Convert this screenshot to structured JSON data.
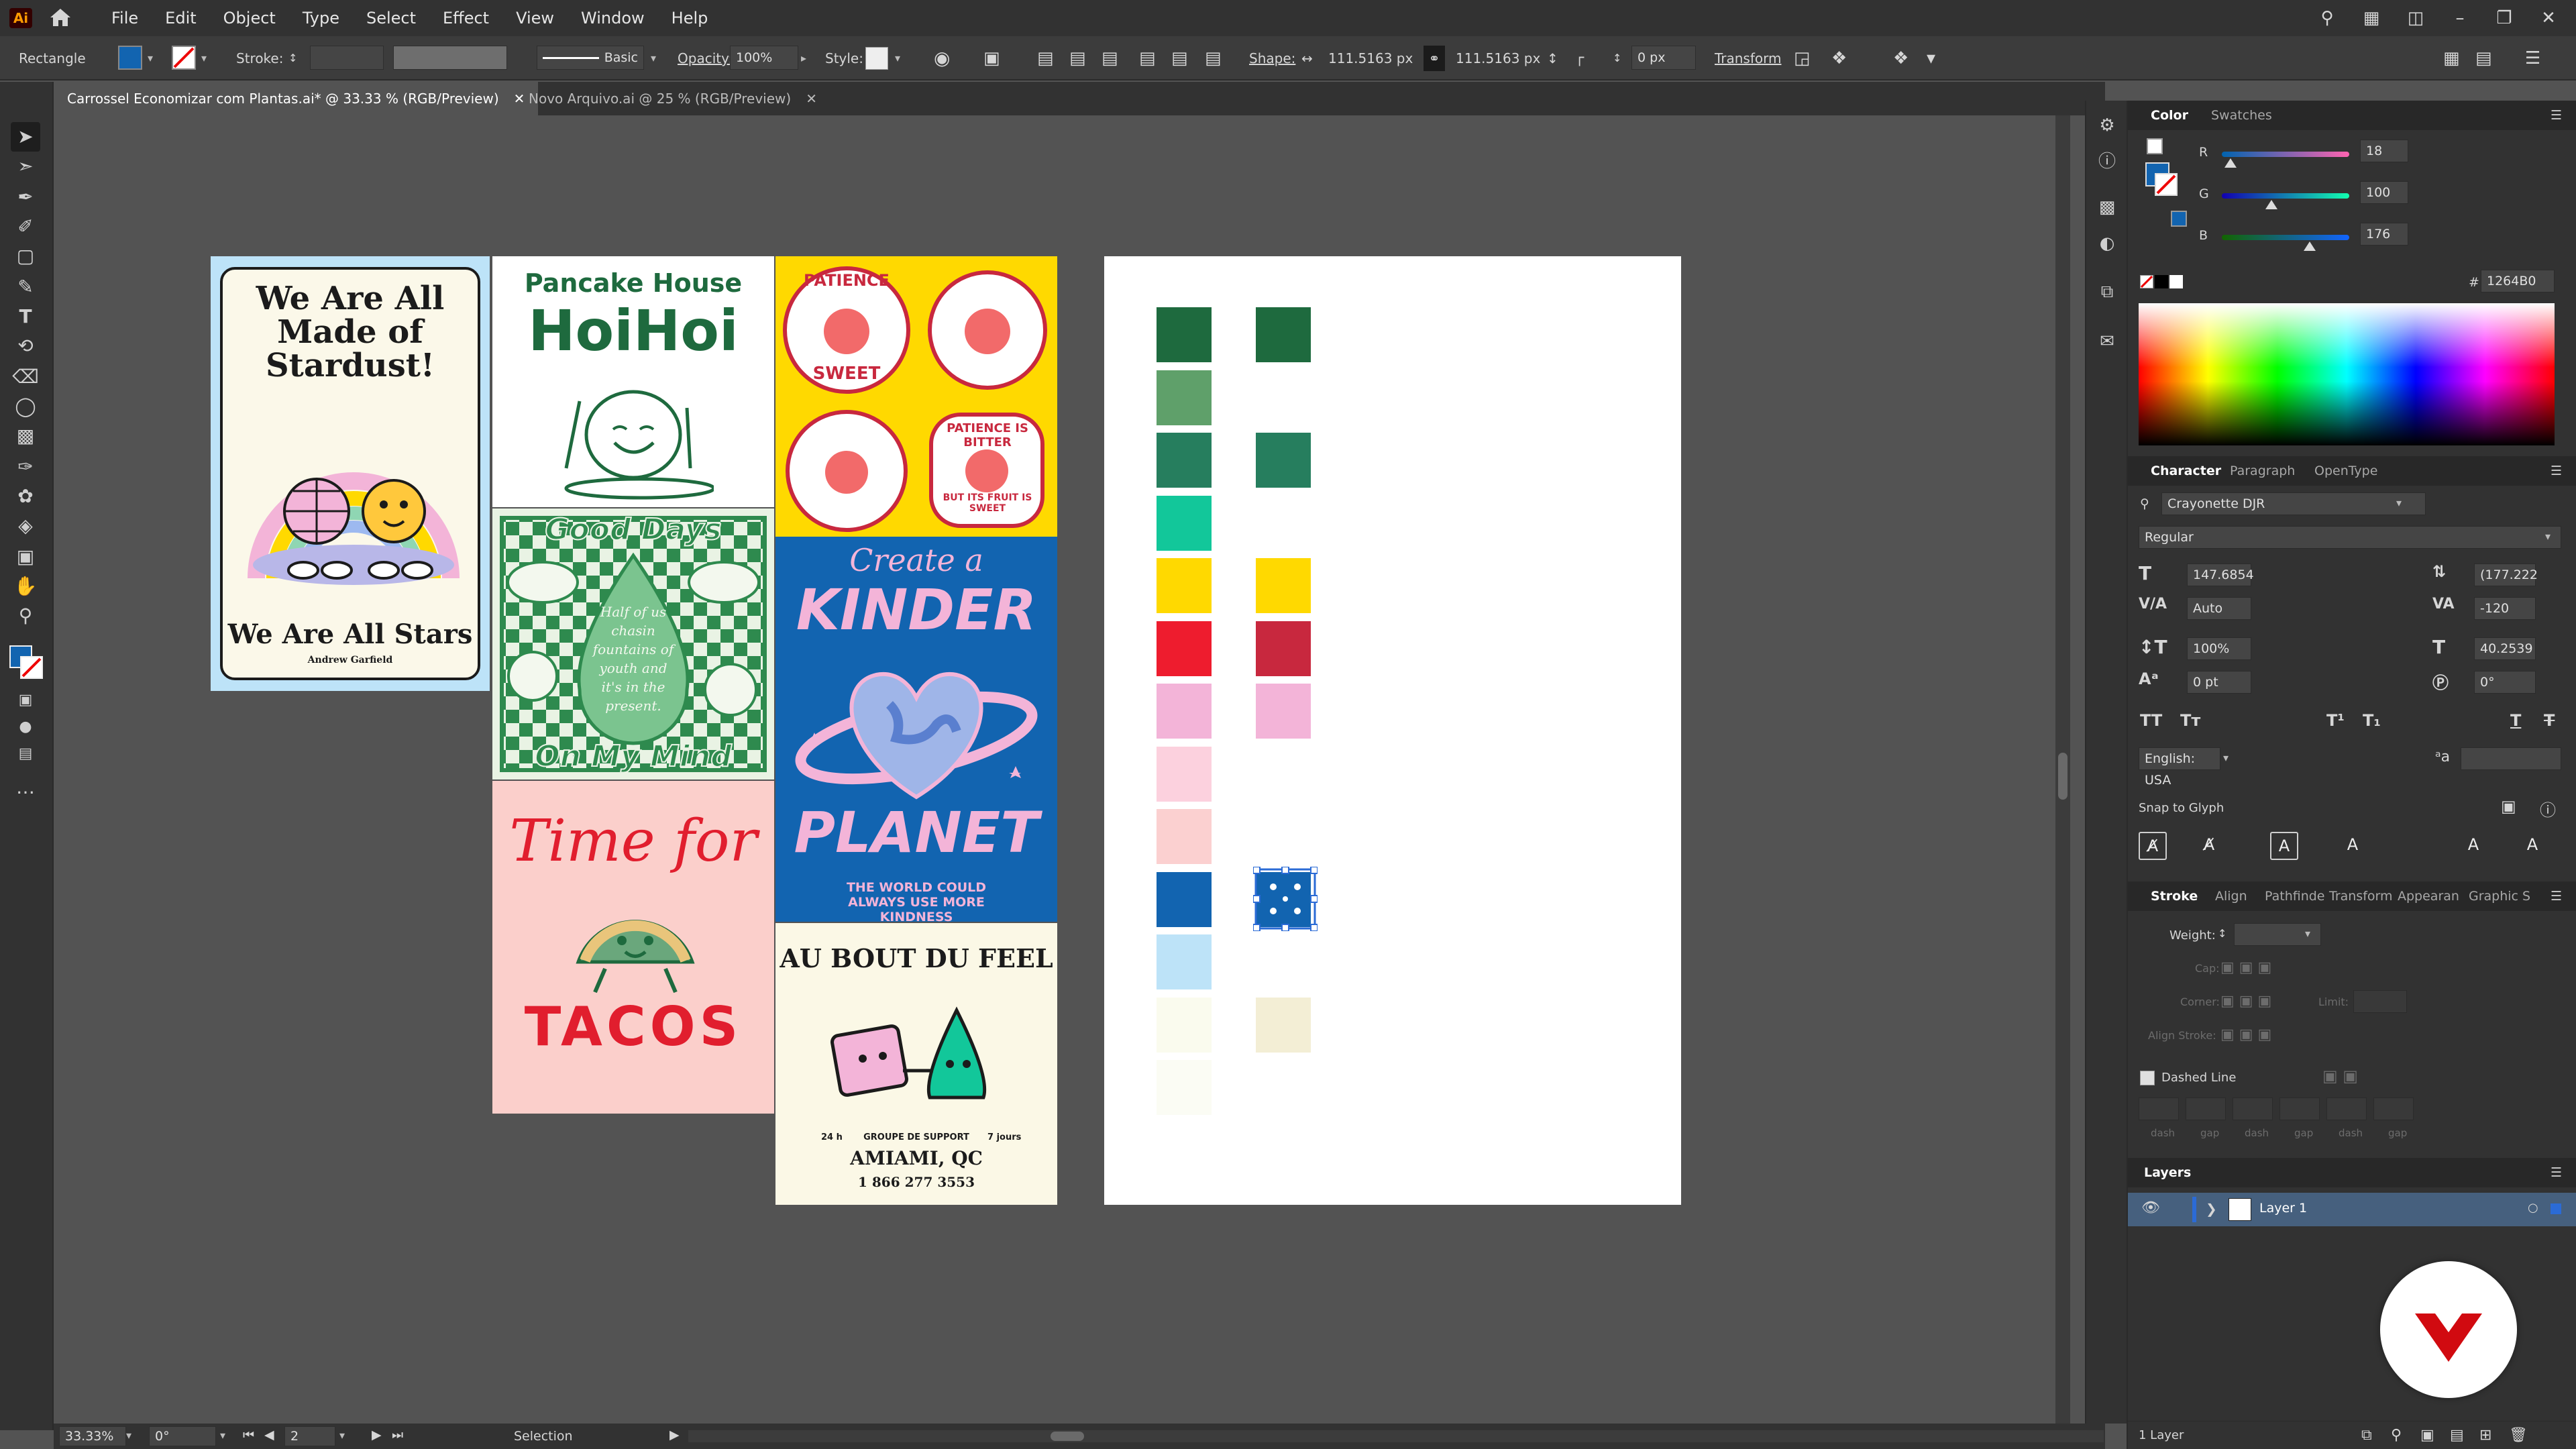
{
  "menubar": {
    "logo": "Ai",
    "menus": [
      "File",
      "Edit",
      "Object",
      "Type",
      "Select",
      "Effect",
      "View",
      "Window",
      "Help"
    ]
  },
  "controlbar": {
    "object_type": "Rectangle",
    "fill_color": "#1264B0",
    "stroke_label": "Stroke:",
    "brush_label": "Basic",
    "opacity_label": "Opacity:",
    "opacity_value": "100%",
    "style_label": "Style:",
    "shape_label": "Shape:",
    "width_value": "111.5163 px",
    "height_value": "111.5163 px",
    "corner_value": "0 px",
    "transform_label": "Transform"
  },
  "tabs": [
    {
      "label": "Carrossel Economizar com Plantas.ai* @ 33.33 % (RGB/Preview)",
      "active": true
    },
    {
      "label": "Novo Arquivo.ai @ 25 % (RGB/Preview)",
      "active": false
    }
  ],
  "posters": {
    "stardust": {
      "title": "We Are All Made of Stardust!",
      "subtitle": "We Are All Stars",
      "author": "Andrew Garfield"
    },
    "pancake": {
      "line1": "Pancake House",
      "line2": "HoiHoi"
    },
    "patience": {
      "badge1": "PATIENCE",
      "badge2": "SWEET",
      "badge3": "PATIENCE IS BITTER",
      "badge4": "BUT ITS FRUIT IS SWEET"
    },
    "gooddays": {
      "top": "Good Days",
      "middle": "Half of us chasin fountains of youth and it's in the present.",
      "bottom": "On My Mind"
    },
    "kinder": {
      "line1": "Create a",
      "line2": "KINDER",
      "line3": "PLANET",
      "footer": "THE WORLD COULD ALWAYS USE MORE KINDNESS"
    },
    "tacos": {
      "line1": "Time for",
      "line2": "TACOS"
    },
    "aubout": {
      "title": "AU BOUT DU FEEL",
      "hours": "24 h",
      "support": "GROUPE DE SUPPORT",
      "days": "7 jours",
      "city": "AMIAMI, QC",
      "phone": "1 866 277 3553"
    }
  },
  "palette": {
    "left": [
      "#1E6A3E",
      "#5FA06A",
      "#267E5E",
      "#12C79A",
      "#FFD900",
      "#EE1C2E",
      "#F3B4D8",
      "#FCD1DE",
      "#FBD0D0",
      "#1264B0",
      "#BDE3F8",
      "#FAFBEE",
      "#FBFCF4"
    ],
    "right": [
      "#1E6A3E",
      "#267E5E",
      "#FFD900",
      "#C8283E",
      "#F3B4D8",
      "#1264B0",
      "#F3EED5"
    ]
  },
  "color_panel": {
    "tabs": [
      "Color",
      "Swatches"
    ],
    "r_label": "R",
    "r_value": "18",
    "g_label": "G",
    "g_value": "100",
    "b_label": "B",
    "b_value": "176",
    "r_fraction": 0.07,
    "g_fraction": 0.39,
    "b_fraction": 0.69,
    "hex_label": "#",
    "hex_value": "1264B0"
  },
  "character_panel": {
    "tabs": [
      "Character",
      "Paragraph",
      "OpenType"
    ],
    "font_family": "Crayonette DJR",
    "font_style": "Regular",
    "font_size": "147.6854",
    "leading": "(177.222",
    "kerning": "Auto",
    "tracking": "-120",
    "vscale": "100%",
    "hscale": "40.2539",
    "baseline": "0 pt",
    "rotation": "0°",
    "language": "English: USA",
    "snap_label": "Snap to Glyph"
  },
  "stroke_panel": {
    "tabs": [
      "Stroke",
      "Align",
      "Pathfinde",
      "Transform",
      "Appearan",
      "Graphic S"
    ],
    "weight_label": "Weight:",
    "cap_label": "Cap:",
    "corner_label": "Corner:",
    "limit_label": "Limit:",
    "align_label": "Align Stroke:",
    "dashed_label": "Dashed Line",
    "dash_labels": [
      "dash",
      "gap",
      "dash",
      "gap",
      "dash",
      "gap"
    ]
  },
  "layers_panel": {
    "title": "Layers",
    "layer_name": "Layer 1",
    "footer": "1 Layer"
  },
  "statusbar": {
    "zoom": "33.33%",
    "rotation": "0°",
    "artboard": "2",
    "tool": "Selection"
  }
}
